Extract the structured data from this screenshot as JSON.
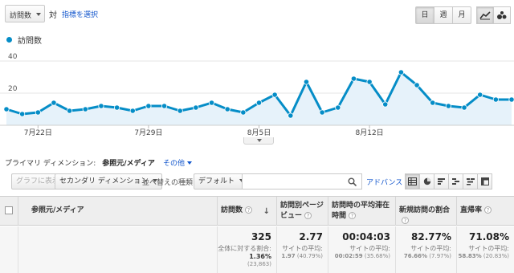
{
  "topbar": {
    "metric_selector": "訪問数",
    "vs_text": "対",
    "select_metric_link": "指標を選択",
    "periods": [
      "日",
      "週",
      "月"
    ],
    "active_period": "日"
  },
  "legend": {
    "label": "訪問数",
    "color": "#058dc7"
  },
  "chart_data": {
    "type": "area",
    "series": [
      {
        "name": "訪問数",
        "values": [
          10,
          7,
          8,
          14,
          9,
          10,
          12,
          11,
          9,
          12,
          12,
          9,
          11,
          14,
          10,
          8,
          14,
          19,
          6,
          27,
          8,
          11,
          29,
          27,
          13,
          33,
          25,
          14,
          12,
          11,
          19,
          16,
          16
        ]
      }
    ],
    "x_tick_labels": [
      "7月22日",
      "7月29日",
      "8月5日",
      "8月12日"
    ],
    "y_tick_labels": [
      "40",
      "20"
    ],
    "ylim": [
      0,
      48
    ],
    "grid": true,
    "line_color": "#058dc7",
    "fill_color": "#e6f2fa"
  },
  "dimension_bar": {
    "label": "プライマリ ディメンション:",
    "active": "参照元/メディア",
    "other": "その他"
  },
  "toolbar": {
    "graph_button": "グラフに表示",
    "secondary_dimension": "セカンダリ ディメンション",
    "sort_type_label": "並べ替えの種類:",
    "sort_default": "デフォルト",
    "search_placeholder": "",
    "advanced_link": "アドバンス"
  },
  "table": {
    "headers": {
      "source_medium": "参照元/メディア",
      "visits": "訪問数",
      "pages_per_visit": "訪問別ページビュー",
      "avg_duration": "訪問時の平均滞在時間",
      "new_visits": "新規訪問の割合",
      "bounce_rate": "直帰率"
    },
    "totals": {
      "visits": "325",
      "visits_sub": "全体に対する割合:",
      "visits_pct": "1.36%",
      "visits_total": "(23,863)",
      "pages_per_visit": "2.77",
      "pages_sub": "サイトの平均:",
      "pages_avg": "1.97",
      "pages_diff": "(40.79%)",
      "avg_duration": "00:04:03",
      "duration_sub": "サイトの平均:",
      "duration_avg": "00:02:59",
      "duration_diff": "(35.68%)",
      "new_visits": "82.77%",
      "new_sub": "サイトの平均:",
      "new_avg": "76.66%",
      "new_diff": "(7.97%)",
      "bounce_rate": "71.08%",
      "bounce_sub": "サイトの平均:",
      "bounce_avg": "58.83%",
      "bounce_diff": "(20.83%)"
    }
  }
}
